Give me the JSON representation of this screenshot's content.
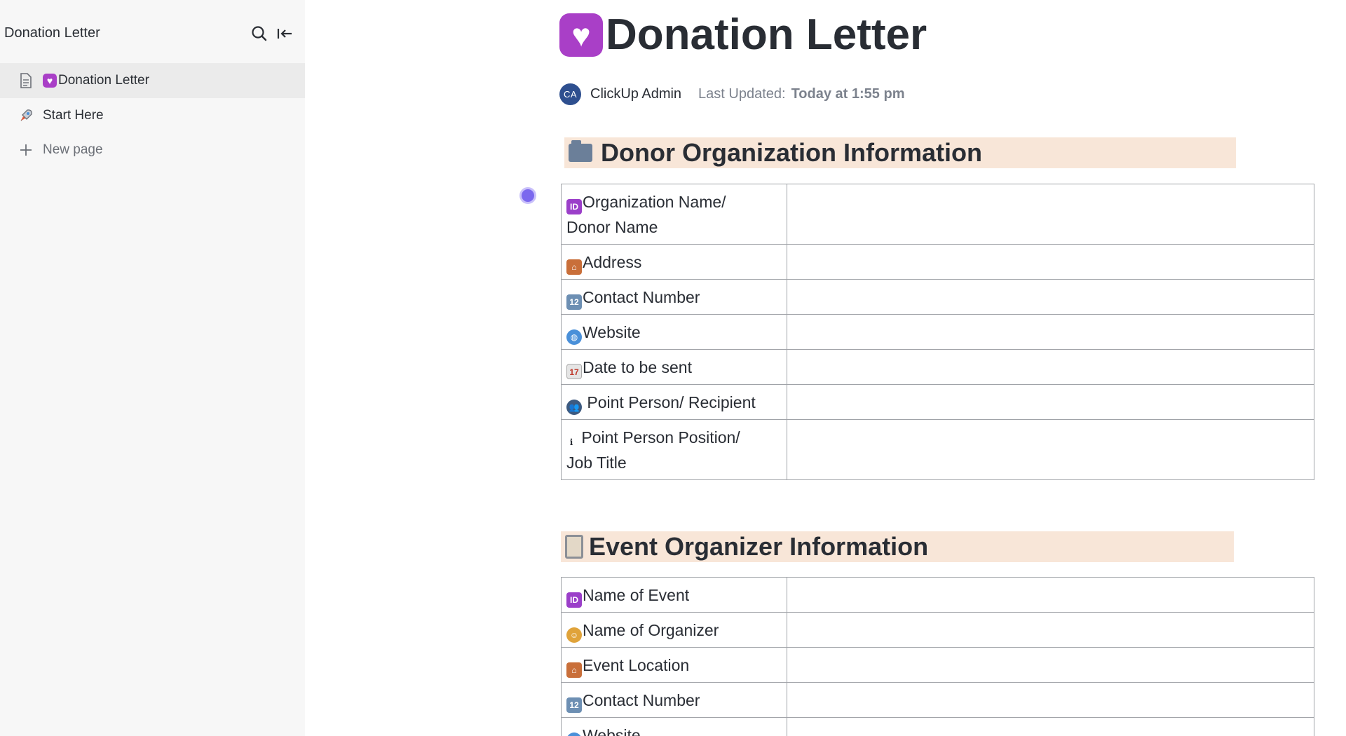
{
  "sidebar": {
    "title": "Donation Letter",
    "items": [
      {
        "icon": "document-icon",
        "emoji": "💟",
        "label": "Donation Letter",
        "active": true
      },
      {
        "icon": "rocket-icon",
        "emoji": "",
        "label": "Start Here",
        "active": false
      },
      {
        "icon": "plus-icon",
        "emoji": "",
        "label": "New page",
        "active": false
      }
    ]
  },
  "doc": {
    "title": "Donation Letter",
    "title_emoji": "💟",
    "author_initials": "CA",
    "author": "ClickUp Admin",
    "updated_label": "Last Updated:",
    "updated_value": "Today at 1:55 pm"
  },
  "sections": [
    {
      "heading": "Donor Organization Information",
      "heading_icon": "folder-icon",
      "rows": [
        {
          "icon": "id-icon",
          "glyph": "ID",
          "label_lines": [
            "Organization Name/",
            "Donor Name"
          ],
          "value": ""
        },
        {
          "icon": "house-icon",
          "glyph": "⌂",
          "label_lines": [
            "Address"
          ],
          "value": ""
        },
        {
          "icon": "numbers-icon",
          "glyph": "12",
          "label_lines": [
            "Contact Number"
          ],
          "value": ""
        },
        {
          "icon": "globe-icon",
          "glyph": "◍",
          "label_lines": [
            "Website"
          ],
          "value": ""
        },
        {
          "icon": "calendar-icon",
          "glyph": "17",
          "label_lines": [
            "Date to be sent"
          ],
          "value": ""
        },
        {
          "icon": "people-icon",
          "glyph": "👥",
          "label_lines": [
            " Point Person/ Recipient"
          ],
          "value": ""
        },
        {
          "icon": "info-icon",
          "glyph": "i",
          "label_lines": [
            " Point Person Position/",
            "Job Title"
          ],
          "value": ""
        }
      ]
    },
    {
      "heading": "Event Organizer Information",
      "heading_icon": "clipboard-icon",
      "rows": [
        {
          "icon": "id-icon",
          "glyph": "ID",
          "label_lines": [
            "Name of Event"
          ],
          "value": ""
        },
        {
          "icon": "person-icon",
          "glyph": "☺",
          "label_lines": [
            "Name of Organizer"
          ],
          "value": ""
        },
        {
          "icon": "house-icon",
          "glyph": "⌂",
          "label_lines": [
            "Event Location"
          ],
          "value": ""
        },
        {
          "icon": "numbers-icon",
          "glyph": "12",
          "label_lines": [
            "Contact Number"
          ],
          "value": ""
        },
        {
          "icon": "globe-icon",
          "glyph": "◍",
          "label_lines": [
            "Website"
          ],
          "value": ""
        }
      ]
    }
  ],
  "colors": {
    "sidebar_bg": "#f7f7f7",
    "active_item_bg": "#ebebeb",
    "heading_highlight": "#f8e6d8",
    "cursor_accent": "#7b68ee",
    "avatar_bg": "#2e4f8f"
  }
}
